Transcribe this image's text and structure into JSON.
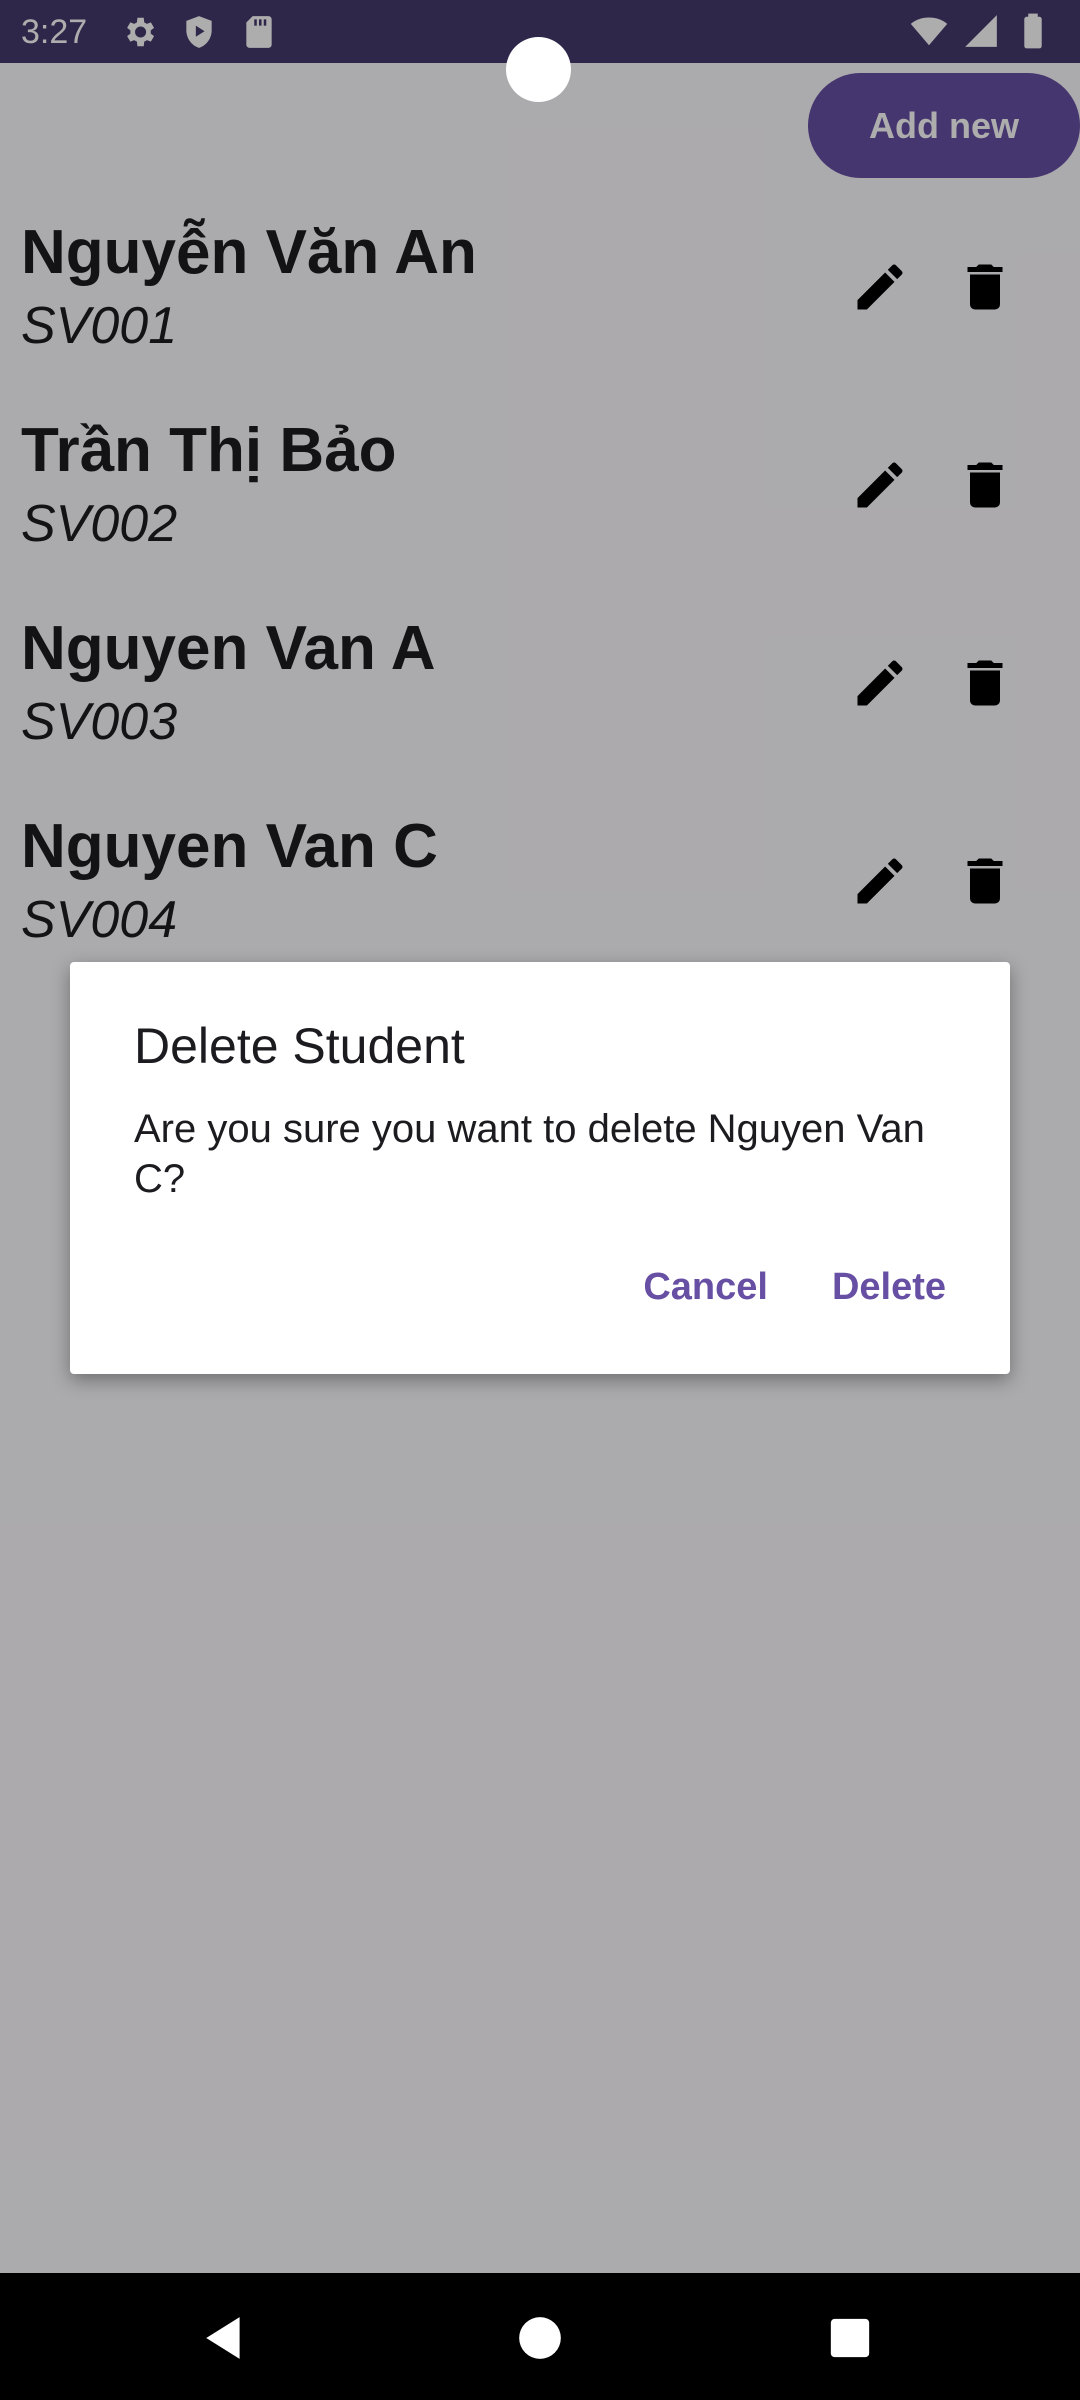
{
  "status_bar": {
    "time": "3:27",
    "icons_left": [
      "gear-icon",
      "shield-play-icon",
      "sd-card-icon"
    ],
    "icons_right": [
      "wifi-icon",
      "cell-signal-icon",
      "battery-icon"
    ],
    "background": "#463a6e"
  },
  "toolbar": {
    "add_label": "Add new"
  },
  "students": [
    {
      "name": "Nguyễn Văn An",
      "id": "SV001"
    },
    {
      "name": "Trần Thị Bảo",
      "id": "SV002"
    },
    {
      "name": "Nguyen Van A",
      "id": "SV003"
    },
    {
      "name": "Nguyen Van C",
      "id": "SV004"
    }
  ],
  "dialog": {
    "title": "Delete Student",
    "message": "Are you sure you want to delete Nguyen Van C?",
    "cancel_label": "Cancel",
    "confirm_label": "Delete"
  },
  "colors": {
    "accent": "#6750a4",
    "scrim": "rgba(0,0,0,0.32)"
  },
  "nav_bar": {
    "icons": [
      "back-icon",
      "home-icon",
      "recents-icon"
    ]
  }
}
